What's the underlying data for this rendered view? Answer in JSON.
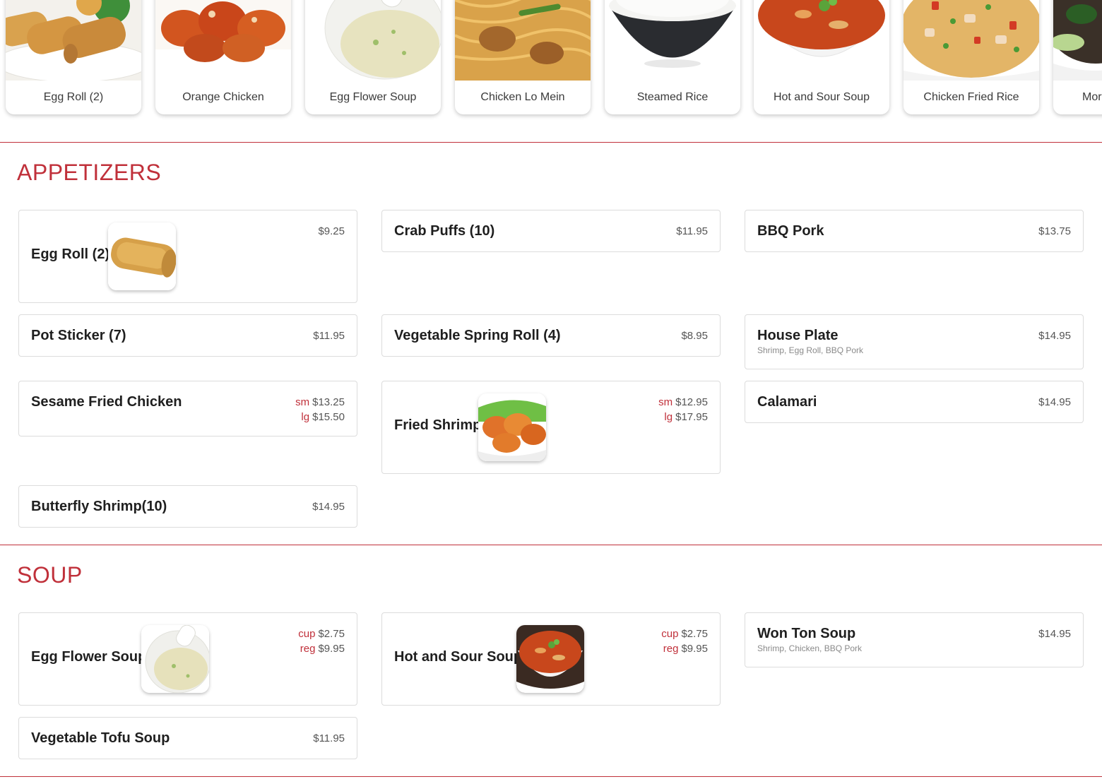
{
  "carousel": {
    "items": [
      {
        "label": "Egg Roll (2)"
      },
      {
        "label": "Orange Chicken"
      },
      {
        "label": "Egg Flower Soup"
      },
      {
        "label": "Chicken Lo Mein"
      },
      {
        "label": "Steamed Rice"
      },
      {
        "label": "Hot and Sour Soup"
      },
      {
        "label": "Chicken Fried Rice"
      },
      {
        "label": "Mor"
      }
    ]
  },
  "sections": {
    "appetizers": {
      "title": "APPETIZERS",
      "items": [
        {
          "name": "Egg Roll (2)",
          "price": "$9.25"
        },
        {
          "name": "Crab Puffs (10)",
          "price": "$11.95"
        },
        {
          "name": "BBQ Pork",
          "price": "$13.75"
        },
        {
          "name": "Pot Sticker (7)",
          "price": "$11.95"
        },
        {
          "name": "Vegetable Spring Roll (4)",
          "price": "$8.95"
        },
        {
          "name": "House Plate",
          "desc": "Shrimp, Egg Roll, BBQ Pork",
          "price": "$14.95"
        },
        {
          "name": "Sesame Fried Chicken",
          "sizes": [
            {
              "size": "sm",
              "price": "$13.25"
            },
            {
              "size": "lg",
              "price": "$15.50"
            }
          ]
        },
        {
          "name": "Fried Shrimp",
          "sizes": [
            {
              "size": "sm",
              "price": "$12.95"
            },
            {
              "size": "lg",
              "price": "$17.95"
            }
          ]
        },
        {
          "name": "Calamari",
          "price": "$14.95"
        },
        {
          "name": "Butterfly Shrimp(10)",
          "price": "$14.95"
        }
      ]
    },
    "soup": {
      "title": "SOUP",
      "items": [
        {
          "name": "Egg Flower Soup",
          "sizes": [
            {
              "size": "cup",
              "price": "$2.75"
            },
            {
              "size": "reg",
              "price": "$9.95"
            }
          ]
        },
        {
          "name": "Hot and Sour Soup",
          "sizes": [
            {
              "size": "cup",
              "price": "$2.75"
            },
            {
              "size": "reg",
              "price": "$9.95"
            }
          ]
        },
        {
          "name": "Won Ton Soup",
          "desc": "Shrimp, Chicken, BBQ Pork",
          "price": "$14.95"
        },
        {
          "name": "Vegetable Tofu Soup",
          "price": "$11.95"
        }
      ]
    }
  },
  "colors": {
    "accent": "#c0303a",
    "text": "#1f1f1f",
    "muted": "#8a8a8a"
  }
}
